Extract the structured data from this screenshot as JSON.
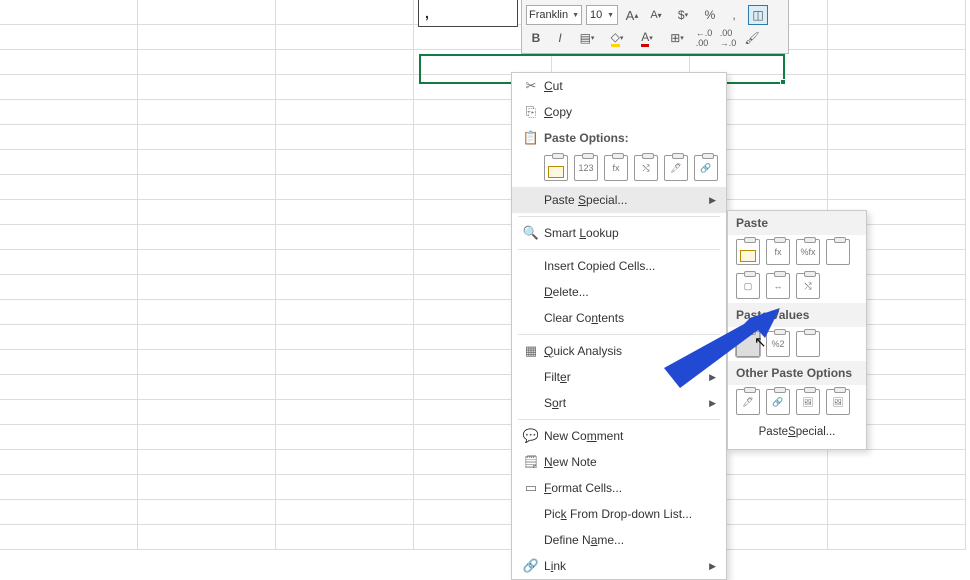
{
  "header_cell_value": ",",
  "toolbar": {
    "font_name": "Franklin",
    "font_size": "10",
    "increase_font": "A▴",
    "decrease_font": "A▾",
    "currency": "$",
    "percent": "%",
    "comma": ",",
    "bold": "B",
    "italic": "I"
  },
  "ctx": {
    "cut": "Cut",
    "copy": "Copy",
    "paste_options": "Paste Options:",
    "paste_special": "Paste Special...",
    "smart_lookup": "Smart Lookup",
    "insert_copied": "Insert Copied Cells...",
    "delete": "Delete...",
    "clear_contents": "Clear Contents",
    "quick_analysis": "Quick Analysis",
    "filter": "Filter",
    "sort": "Sort",
    "new_comment": "New Comment",
    "new_note": "New Note",
    "format_cells": "Format Cells...",
    "pick_list": "Pick From Drop-down List...",
    "define_name": "Define Name...",
    "link": "Link",
    "paste_clip_labels": [
      "",
      "123",
      "fx",
      "",
      "",
      ""
    ]
  },
  "sub": {
    "paste_head": "Paste",
    "paste_values_head": "Paste Values",
    "other_head": "Other Paste Options",
    "paste_special_btn": "Paste Special...",
    "row1": [
      "",
      "fx",
      "%fx",
      ""
    ],
    "row2": [
      "",
      "",
      ""
    ],
    "values_row": [
      "",
      "%2",
      ""
    ],
    "other_row": [
      "",
      "",
      "",
      ""
    ]
  }
}
